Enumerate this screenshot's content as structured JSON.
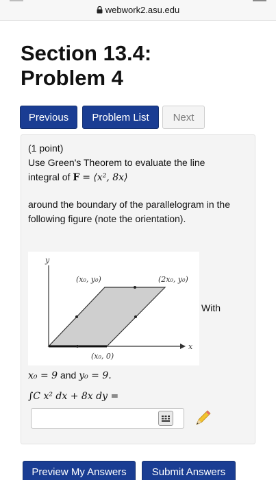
{
  "browser": {
    "url": "webwork2.asu.edu"
  },
  "page": {
    "title_line1": "Section 13.4:",
    "title_line2": "Problem 4"
  },
  "nav": {
    "previous": "Previous",
    "problem_list": "Problem List",
    "next": "Next"
  },
  "problem": {
    "points": "(1 point)",
    "line1": "Use Green's Theorem to evaluate the line",
    "line2_prefix": "integral of",
    "vector_name": "F",
    "vector_expr": "= ⟨x², 8x⟩",
    "line3": "around the boundary of the parallelogram in the",
    "line4": "following figure (note the orientation).",
    "with_text": "With",
    "given_x": "x₀ = 9",
    "and_text": "and",
    "given_y": "y₀ = 9.",
    "integral": "∫C x² dx + 8x dy ="
  },
  "figure": {
    "y_axis_label": "y",
    "x_axis_label": "x",
    "label_top_left": "(x₀, y₀)",
    "label_top_right": "(2x₀, y₀)",
    "label_bottom": "(x₀, 0)"
  },
  "answer": {
    "value": "",
    "placeholder": ""
  },
  "buttons": {
    "preview": "Preview My Answers",
    "submit": "Submit Answers"
  }
}
